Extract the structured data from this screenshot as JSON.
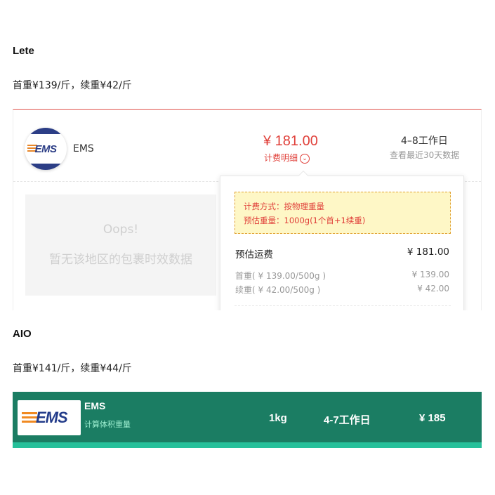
{
  "lete": {
    "title": "Lete",
    "rate": "首重¥139/斤，续重¥42/斤",
    "carrier": "EMS",
    "logo_text": "EMS",
    "price": "¥ 181.00",
    "detail_label": "计费明细",
    "delivery_days": "4–8工作日",
    "delivery_sub": "查看最近30天数据",
    "oops_title": "Oops!",
    "oops_text": "暂无该地区的包裹时效数据",
    "popover": {
      "note_line1": "计费方式：按物理重量",
      "note_line2": "预估重量：1000g(1个首+1续重)",
      "est_label": "预估运费",
      "est_total": "¥ 181.00",
      "first_label": "首重( ¥ 139.00/500g )",
      "first_value": "¥ 139.00",
      "cont_label": "续重( ¥ 42.00/500g )",
      "cont_value": "¥ 42.00"
    }
  },
  "aio": {
    "title": "AIO",
    "rate": "首重¥141/斤，续重¥44/斤",
    "carrier": "EMS",
    "logo_text": "EMS",
    "sub_label": "计算体积重量",
    "weight": "1kg",
    "delivery_days": "4-7工作日",
    "price": "¥ 185"
  },
  "colors": {
    "price_red": "#e0403a",
    "aio_green": "#1b7d63",
    "ems_blue": "#2c3e86",
    "ems_orange": "#e8872a"
  }
}
